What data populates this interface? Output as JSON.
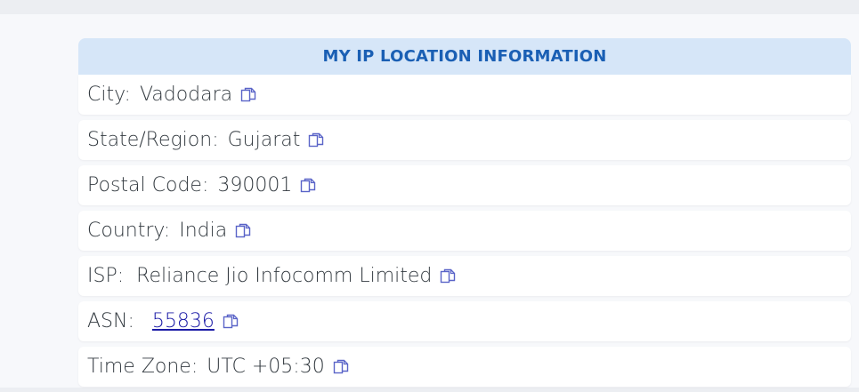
{
  "header": {
    "title": "MY IP LOCATION INFORMATION"
  },
  "rows": [
    {
      "label": "City:",
      "value": "Vadodara"
    },
    {
      "label": "State/Region:",
      "value": "Gujarat"
    },
    {
      "label": "Postal Code:",
      "value": "390001"
    },
    {
      "label": "Country:",
      "value": "India"
    },
    {
      "label": "ISP:",
      "value": "Reliance Jio Infocomm Limited"
    },
    {
      "label": "ASN:",
      "value": "55836"
    },
    {
      "label": "Time Zone:",
      "value": "UTC +05:30"
    }
  ],
  "icons": {
    "copy": "copy-icon"
  },
  "colors": {
    "header_bg": "#d6e6f8",
    "header_text": "#1a5fb4",
    "link": "#1a1aa6",
    "icon": "#5a64c8"
  }
}
